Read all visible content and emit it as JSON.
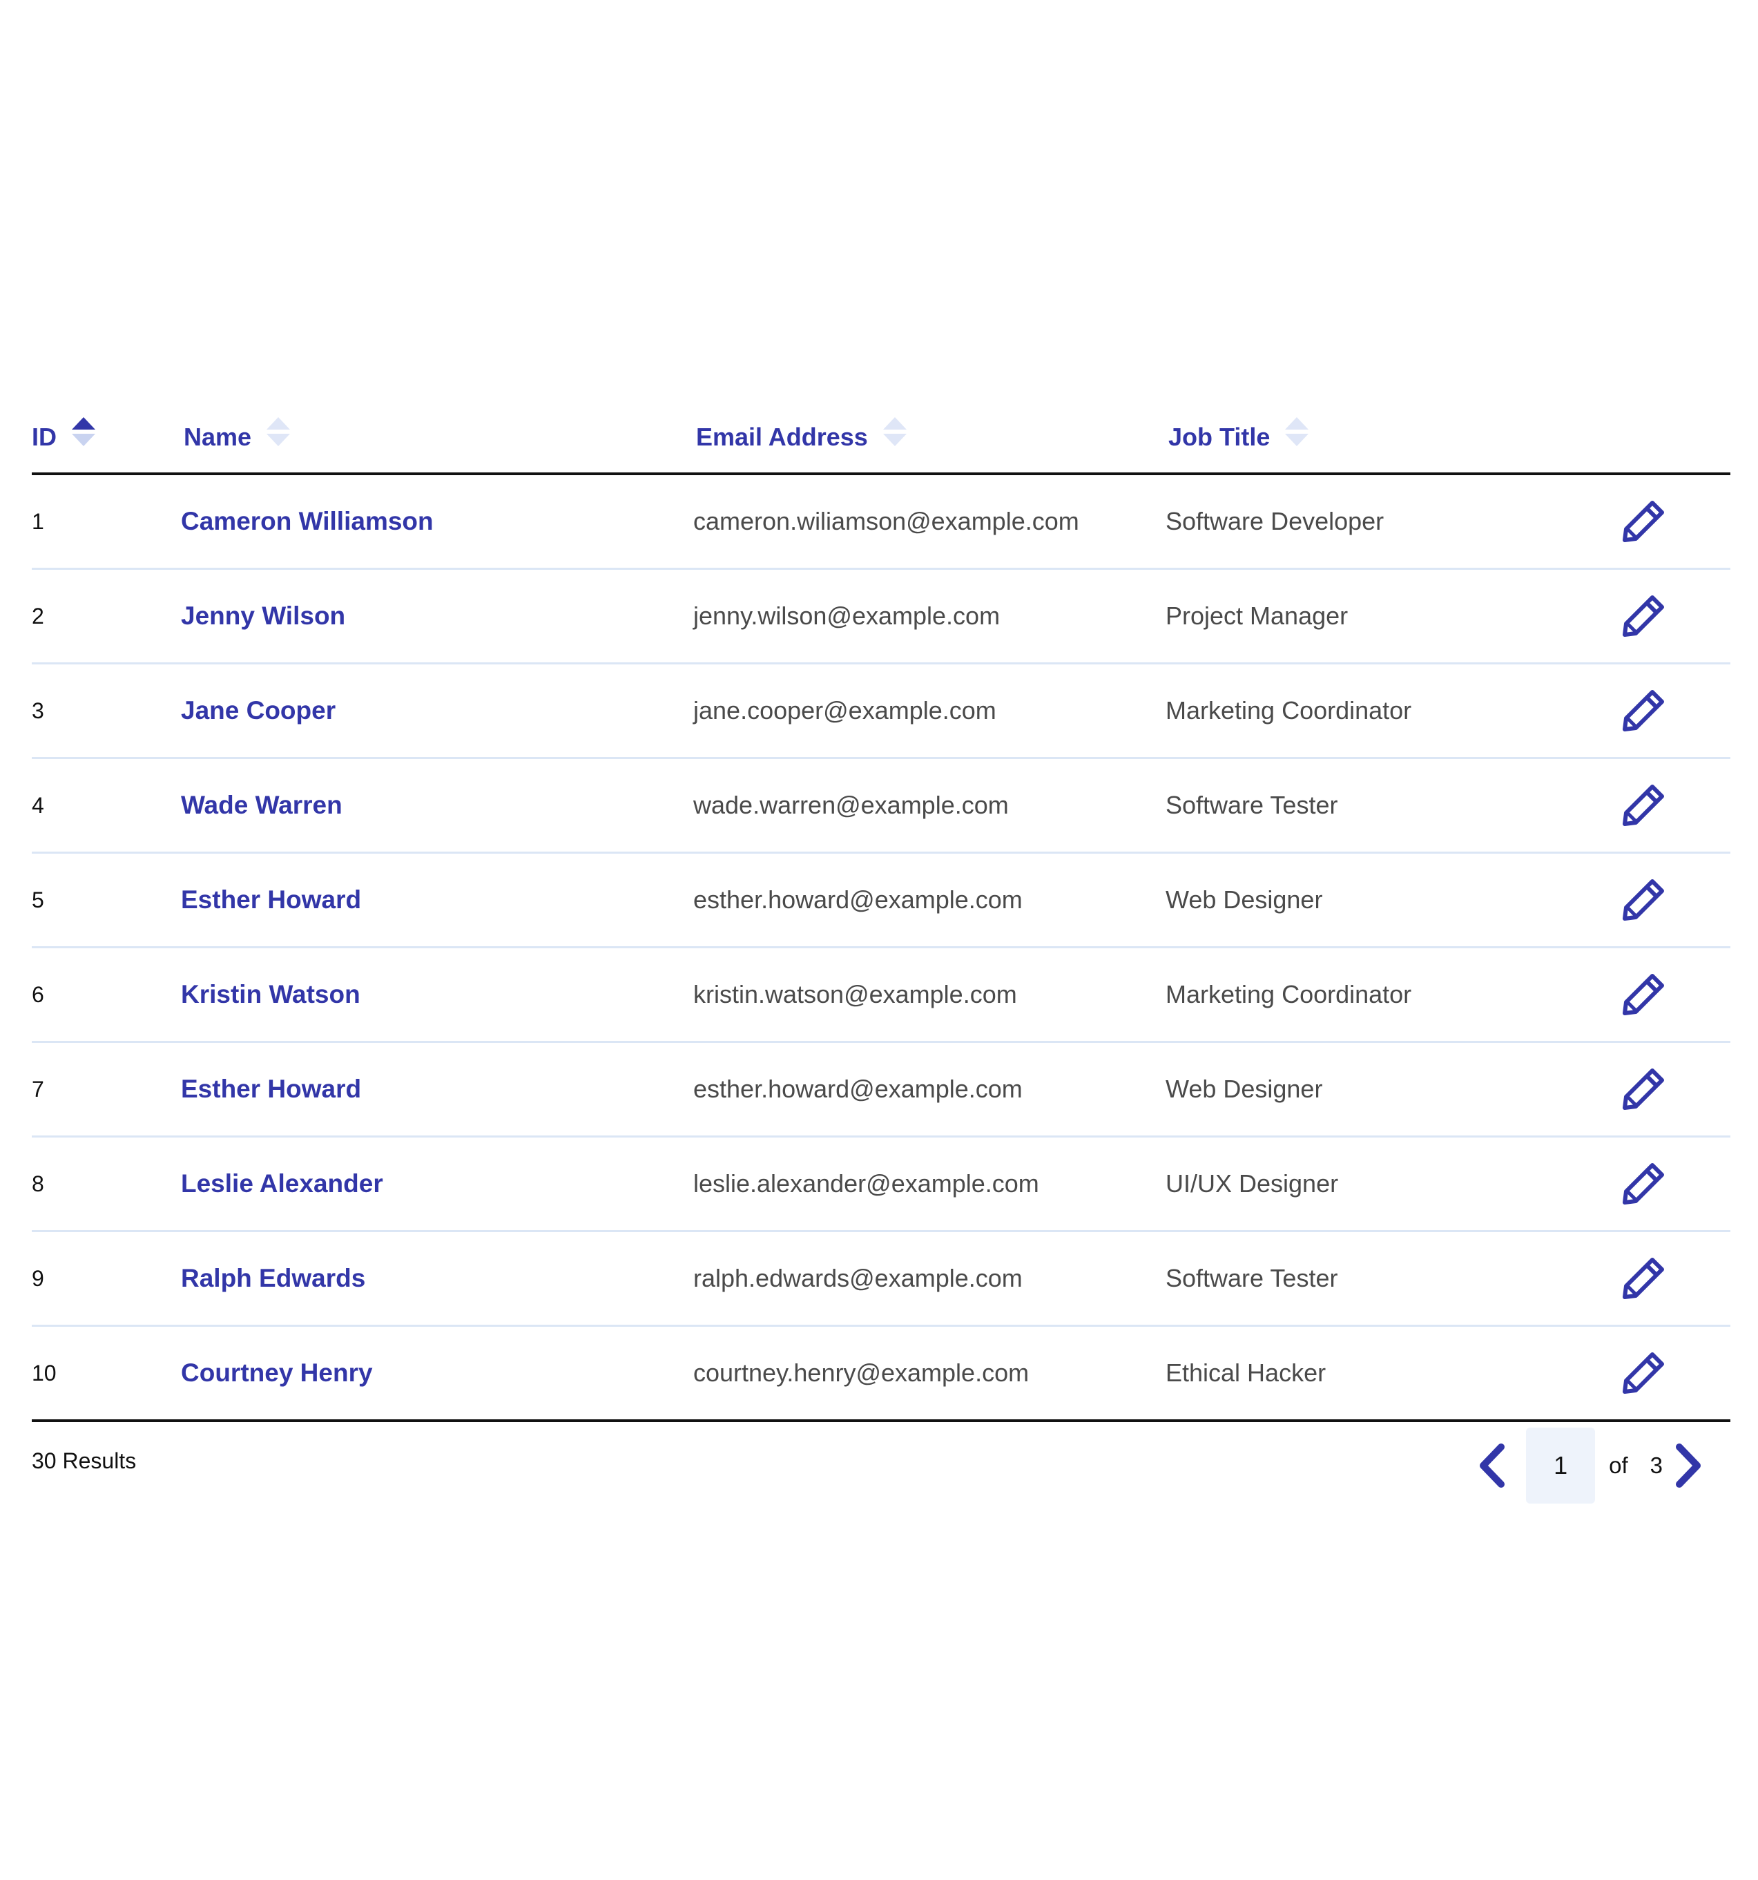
{
  "table": {
    "columns": {
      "id": "ID",
      "name": "Name",
      "email": "Email Address",
      "job": "Job Title"
    },
    "sort_active_column": "id",
    "rows": [
      {
        "id": "1",
        "name": "Cameron Williamson",
        "email": "cameron.wiliamson@example.com",
        "job": "Software Developer"
      },
      {
        "id": "2",
        "name": "Jenny Wilson",
        "email": "jenny.wilson@example.com",
        "job": "Project Manager"
      },
      {
        "id": "3",
        "name": "Jane Cooper",
        "email": "jane.cooper@example.com",
        "job": "Marketing Coordinator"
      },
      {
        "id": "4",
        "name": "Wade Warren",
        "email": "wade.warren@example.com",
        "job": "Software Tester"
      },
      {
        "id": "5",
        "name": "Esther Howard",
        "email": "esther.howard@example.com",
        "job": "Web Designer"
      },
      {
        "id": "6",
        "name": "Kristin Watson",
        "email": "kristin.watson@example.com",
        "job": "Marketing Coordinator"
      },
      {
        "id": "7",
        "name": "Esther Howard",
        "email": "esther.howard@example.com",
        "job": "Web Designer"
      },
      {
        "id": "8",
        "name": "Leslie Alexander",
        "email": "leslie.alexander@example.com",
        "job": "UI/UX Designer"
      },
      {
        "id": "9",
        "name": "Ralph Edwards",
        "email": "ralph.edwards@example.com",
        "job": "Software Tester"
      },
      {
        "id": "10",
        "name": "Courtney Henry",
        "email": "courtney.henry@example.com",
        "job": "Ethical Hacker"
      }
    ],
    "row_action_icon": "pencil-icon"
  },
  "footer": {
    "results_label": "30 Results",
    "current_page": "1",
    "of_label": "of",
    "total_pages": "3",
    "prev_icon": "chevron-left-icon",
    "next_icon": "chevron-right-icon"
  },
  "colors": {
    "accent": "#3236a8",
    "row_divider": "#dbe6f5",
    "page_box_bg": "#eef3fb"
  }
}
